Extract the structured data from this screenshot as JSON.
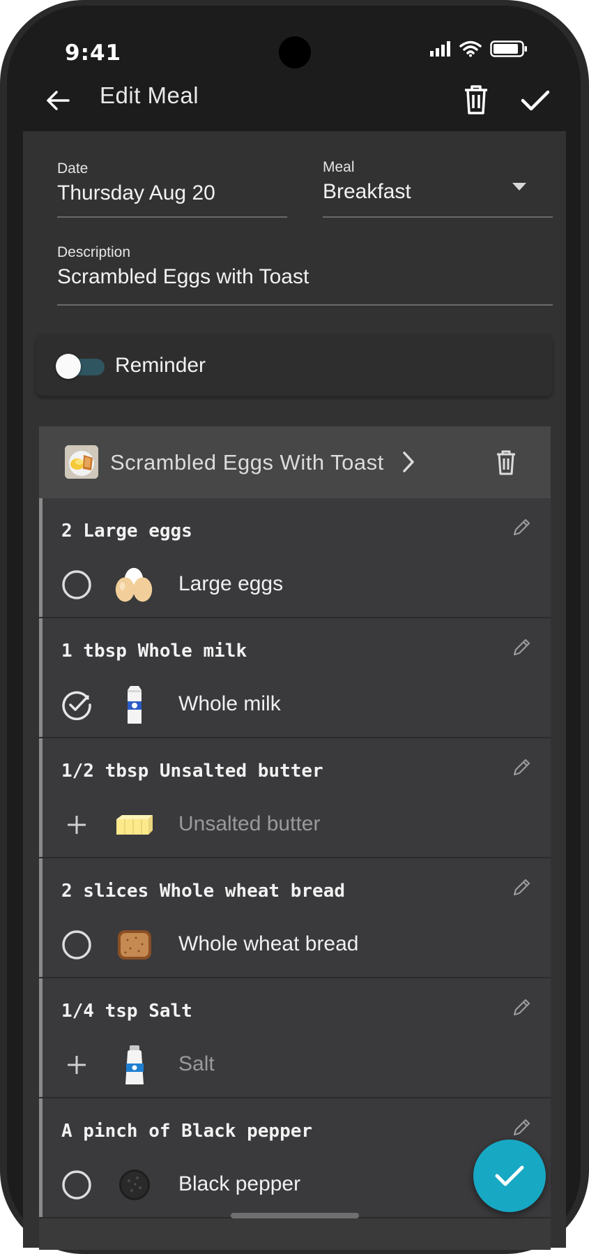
{
  "status_bar": {
    "time": "9:41"
  },
  "app_bar": {
    "title": "Edit Meal"
  },
  "form": {
    "date_label": "Date",
    "date_value": "Thursday Aug 20",
    "meal_label": "Meal",
    "meal_value": "Breakfast",
    "description_label": "Description",
    "description_value": "Scrambled Eggs with Toast"
  },
  "reminder": {
    "label": "Reminder",
    "enabled": false
  },
  "recipe": {
    "title": "Scrambled Eggs With Toast",
    "ingredients": [
      {
        "quantity": "2 Large eggs",
        "name": "Large eggs",
        "status": "unchecked",
        "image": "eggs-icon"
      },
      {
        "quantity": "1 tbsp Whole milk",
        "name": "Whole milk",
        "status": "checked",
        "image": "milk-carton-icon"
      },
      {
        "quantity": "1/2 tbsp Unsalted butter",
        "name": "Unsalted butter",
        "status": "add",
        "image": "butter-icon"
      },
      {
        "quantity": "2 slices Whole wheat bread",
        "name": "Whole wheat bread",
        "status": "unchecked",
        "image": "bread-icon"
      },
      {
        "quantity": "1/4 tsp Salt",
        "name": "Salt",
        "status": "add",
        "image": "salt-shaker-icon"
      },
      {
        "quantity": "A pinch of Black pepper",
        "name": "Black pepper",
        "status": "unchecked",
        "image": "pepper-icon"
      }
    ]
  },
  "colors": {
    "accent": "#17a8c4",
    "background": "#323232",
    "app_bar": "#1c1c1c"
  }
}
